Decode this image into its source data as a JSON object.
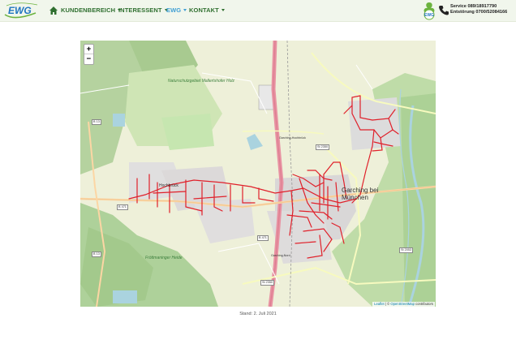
{
  "header": {
    "logo_text": "EWG",
    "nav": [
      {
        "label": "KUNDENBEREICH"
      },
      {
        "label": "INTERESSENT"
      },
      {
        "label": "EWG"
      },
      {
        "label": "KONTAKT"
      }
    ],
    "badge_text": "EWG",
    "service_line": "Service 089/18917790",
    "stoerung_line": "Entstörung 0700/52084166",
    "colors": {
      "nav_text": "#2f6f2f",
      "nav_active": "#3f9fd4",
      "logo_blue": "#1f74c0",
      "logo_green": "#6cb33f",
      "network": "#e0202a"
    }
  },
  "map": {
    "zoom_in": "+",
    "zoom_out": "−",
    "labels": {
      "town": "Garching bei München",
      "forest1": "Naturschutzgebiet Mallertshofer Holz",
      "hochbrueck": "Hochbrück",
      "forest2": "Fröttmaninger Heide",
      "road_b13": "B 13",
      "road_b471": "B 471",
      "road_st2350": "St 2350",
      "road_st2053": "St 2053",
      "garching_nord": "Garching-Nord",
      "garching_hochbrueck": "Garching-Hochbrück"
    },
    "attribution_leaflet": "Leaflet",
    "attribution_sep": " | © ",
    "attribution_osm": "OpenStreetMap",
    "attribution_rest": " contributors"
  },
  "footer": {
    "stand": "Stand: 2. Juli 2021"
  }
}
